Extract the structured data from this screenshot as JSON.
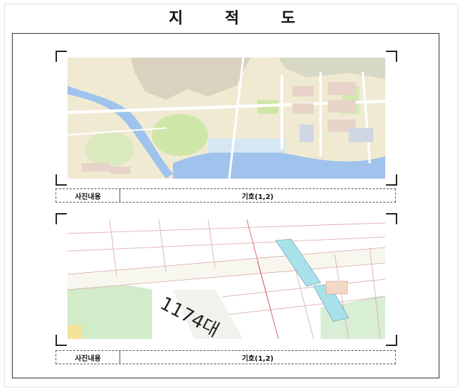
{
  "document": {
    "title": "지 적 도"
  },
  "panels": [
    {
      "map_kind": "aerial-overview",
      "caption_label": "사진내용",
      "caption_value": "기호(1,2)"
    },
    {
      "map_kind": "cadastral-detail",
      "caption_label": "사진내용",
      "caption_value": "기호(1,2)",
      "map_label": "1174대"
    }
  ],
  "colors": {
    "water": "#9fc3ec",
    "park": "#cfe6a9",
    "urban": "#f1ead3",
    "road": "#ffffff",
    "parcel_line": "#d9a7a7",
    "highlight_parcel": "#a9e1ea"
  }
}
